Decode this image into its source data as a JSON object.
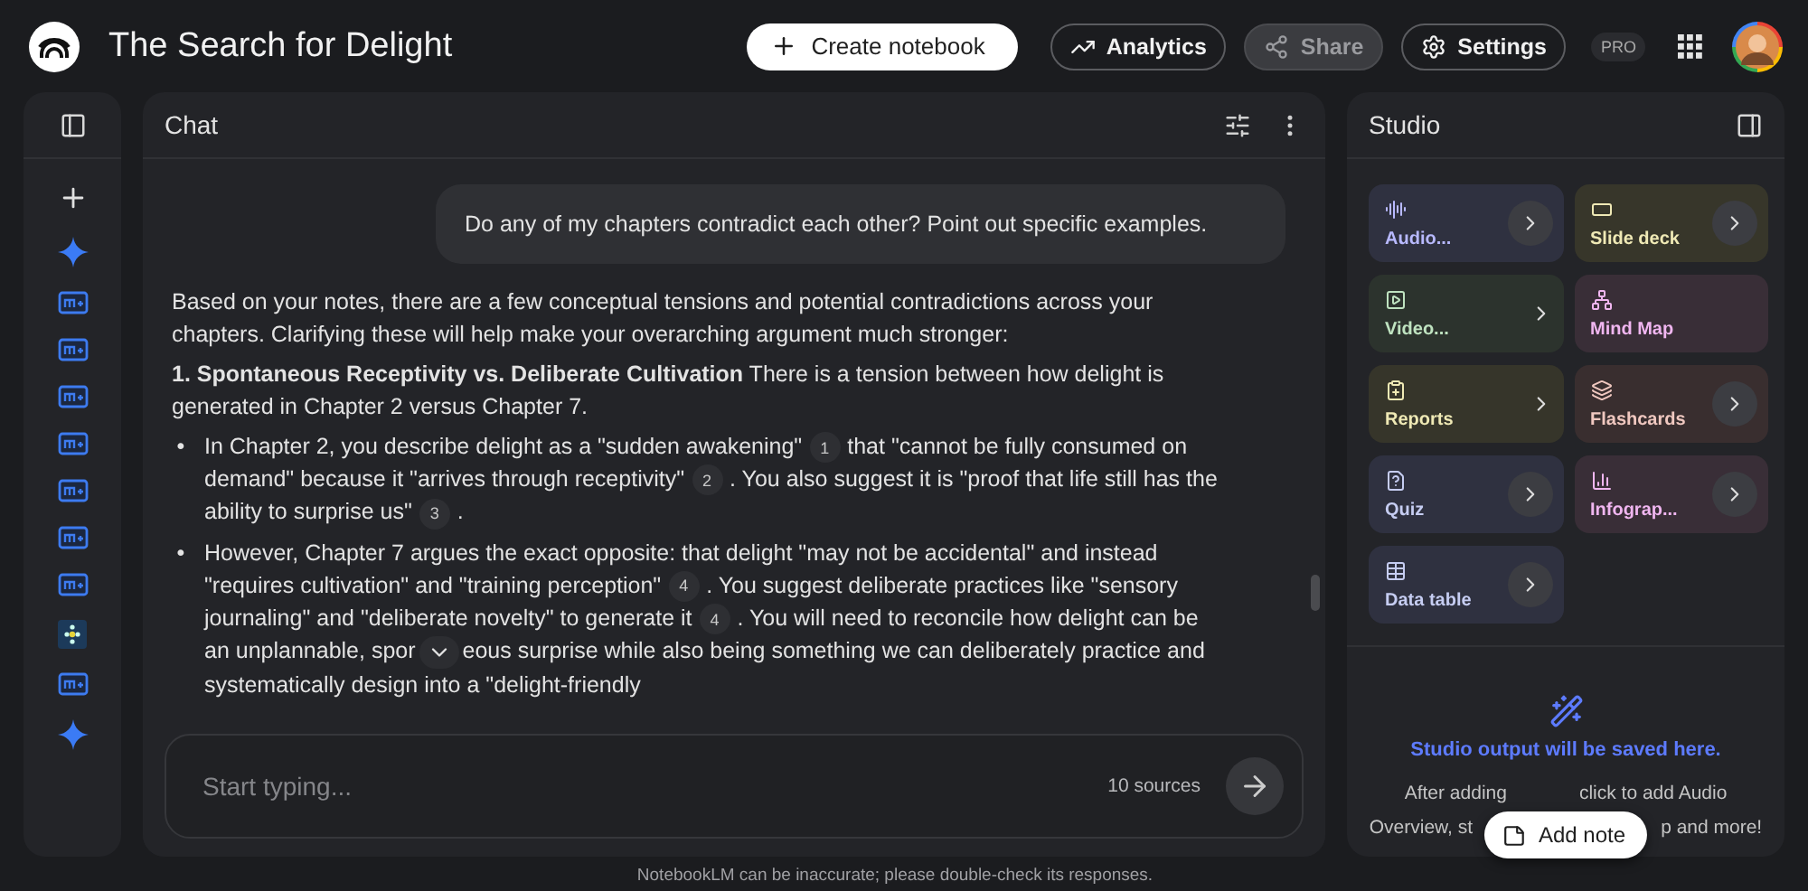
{
  "app": {
    "title": "The Search for Delight"
  },
  "topbar": {
    "create_button": "Create notebook",
    "buttons": [
      {
        "kind": "analytics",
        "label": "Analytics",
        "disabled": false
      },
      {
        "kind": "share",
        "label": "Share",
        "disabled": true
      },
      {
        "kind": "settings",
        "label": "Settings",
        "disabled": false
      }
    ],
    "badge": "PRO"
  },
  "chat": {
    "title": "Chat",
    "user_message": "Do any of my chapters contradict each other? Point out specific examples.",
    "paragraphs": [
      "Based on your notes, there are a few conceptual tensions and potential contradictions across your chapters. Clarifying these will help make your overarching argument much stronger:",
      "**1. Spontaneous Receptivity vs. Deliberate Cultivation** There is a tension between how delight is generated in Chapter 2 versus Chapter 7."
    ],
    "bullets": [
      {
        "marker": "•",
        "segments": [
          {
            "kind": "text",
            "text": "In Chapter 2, you describe delight as a \"sudden awakening\""
          },
          {
            "kind": "cite",
            "text": "1"
          },
          {
            "kind": "text",
            "text": "that \"cannot be fully consumed on demand\" because it \"arrives through receptivity\""
          },
          {
            "kind": "cite",
            "text": "2"
          },
          {
            "kind": "text",
            "text": ". You also suggest it is \"proof that life still has the ability to surprise us\""
          },
          {
            "kind": "cite",
            "text": "3"
          },
          {
            "kind": "text",
            "text": "."
          }
        ]
      },
      {
        "marker": "•",
        "segments": [
          {
            "kind": "text",
            "text": "However, Chapter 7 argues the exact opposite: that delight \"may not be accidental\" and instead \"requires cultivation\" and \"training perception\""
          },
          {
            "kind": "cite",
            "text": "4"
          },
          {
            "kind": "text",
            "text": ". You suggest deliberate practices like \"sensory journaling\" and \"deliberate novelty\" to generate it"
          },
          {
            "kind": "cite",
            "text": "4"
          },
          {
            "kind": "text",
            "text": ". You will need to reconcile how delight can be an unplannable, spor"
          },
          {
            "kind": "scroll"
          },
          {
            "kind": "text",
            "text": "eous surprise while also being something we can deliberately practice and systematically design into a \"delight-friendly"
          }
        ]
      }
    ],
    "input": {
      "placeholder": "Start typing...",
      "sources": "10 sources"
    }
  },
  "studio": {
    "title": "Studio",
    "tiles": [
      {
        "kind": "circle",
        "label": "Audio...",
        "color": "#2f3140"
      },
      {
        "kind": "circle",
        "label": "Slide deck",
        "color": "#37362a"
      },
      {
        "kind": "chevron",
        "label": "Video...",
        "color": "#2c332d"
      },
      {
        "kind": "plain",
        "label": "Mind Map",
        "color": "#392e37"
      },
      {
        "kind": "chevron",
        "label": "Reports",
        "color": "#36352a"
      },
      {
        "kind": "circle",
        "label": "Flashcards",
        "color": "#392e2f"
      },
      {
        "kind": "circle",
        "label": "Quiz",
        "color": "#2f3140"
      },
      {
        "kind": "circle",
        "label": "Infograp...",
        "color": "#392e37"
      },
      {
        "kind": "circle",
        "label": "Data table",
        "color": "#2f3140"
      }
    ],
    "empty_title": "Studio output will be saved here.",
    "empty_lines": [
      [
        "After adding",
        "click to add Audio"
      ],
      [
        "Overview, st",
        "p and more!"
      ]
    ],
    "add_note": "Add note"
  },
  "footer": "NotebookLM can be inaccurate; please double-check its responses."
}
